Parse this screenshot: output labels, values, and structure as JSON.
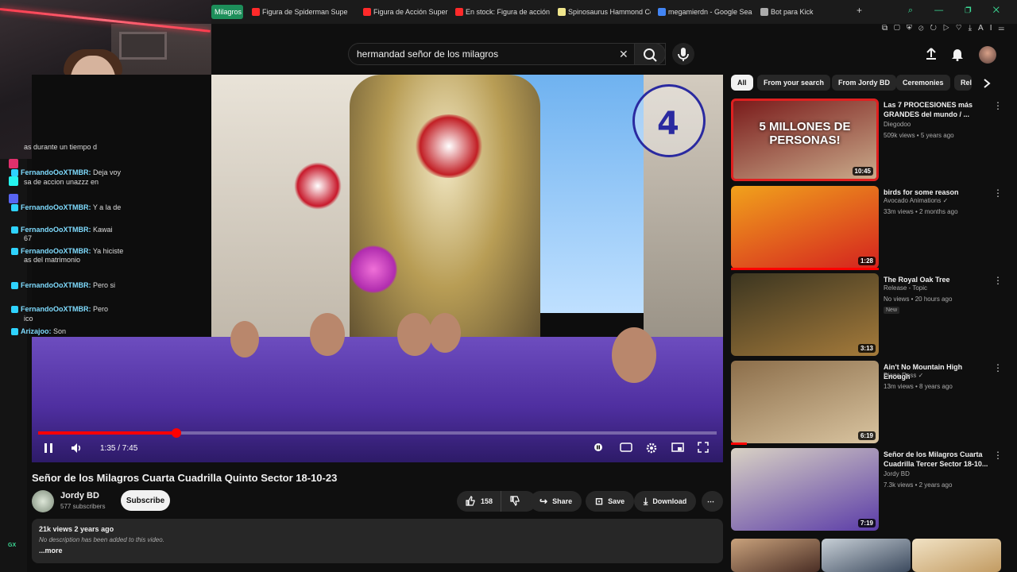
{
  "browser": {
    "tabs": [
      {
        "label": "Milagros C",
        "active": true,
        "fav": "#1d8f5a"
      },
      {
        "label": "Figura de Spiderman Supe",
        "fav": "#ff2a2a"
      },
      {
        "label": "Figura de Acción Superior",
        "fav": "#ff2a2a"
      },
      {
        "label": "En stock: Figura de acción",
        "fav": "#ff2a2a"
      },
      {
        "label": "Spinosaurus Hammond Co",
        "fav": "#f0e68c"
      },
      {
        "label": "megamierdn - Google Sea",
        "fav": "#4285f4"
      },
      {
        "label": "Bot para Kick",
        "fav": "#aaaaaa"
      }
    ],
    "new_tab": "+",
    "ext_ai": "AI"
  },
  "search": {
    "query": "hermandad señor de los milagros",
    "clear_icon": "✕",
    "search_icon": "🔍",
    "mic_icon": "🎙"
  },
  "header_icons": {
    "upload": "⤒",
    "bell": "🔔"
  },
  "chat": [
    {
      "user": "",
      "msg": "as durante un tiempo d"
    },
    {
      "user": "FernandoOoXTMBR:",
      "msg": "Deja voy"
    },
    {
      "user": "",
      "msg": "sa de accion unazzz en"
    },
    {
      "user": "FernandoOoXTMBR:",
      "msg": "Y a la de"
    },
    {
      "user": "FernandoOoXTMBR:",
      "msg": "Kawai"
    },
    {
      "user": "",
      "msg": "67"
    },
    {
      "user": "FernandoOoXTMBR:",
      "msg": "Ya hiciste"
    },
    {
      "user": "",
      "msg": "as del matrimonio"
    },
    {
      "user": "FernandoOoXTMBR:",
      "msg": "Pero si"
    },
    {
      "user": "FernandoOoXTMBR:",
      "msg": "Pero"
    },
    {
      "user": "",
      "msg": "ico"
    },
    {
      "user": "Arizajoo:",
      "msg": "Son"
    }
  ],
  "strip_label": "GX",
  "player": {
    "time": "1:35 / 7:45",
    "progress": 0.204,
    "watermark_number": "4"
  },
  "video": {
    "title": "Señor de los Milagros Cuarta Cuadrilla Quinto Sector 18-10-23",
    "channel": "Jordy BD",
    "subscribers": "577 subscribers",
    "subscribe_label": "Subscribe",
    "likes": "158",
    "share_label": "Share",
    "save_label": "Save",
    "download_label": "Download",
    "more_actions": "⋯",
    "views_date": "21k views  2 years ago",
    "description": "No description has been added to this video.",
    "more_label": "...more"
  },
  "chips": [
    "All",
    "From your search",
    "From Jordy BD",
    "Ceremonies",
    "Rel"
  ],
  "recommendations": [
    {
      "title": "Las 7 PROCESIONES más GRANDES del mundo / ...",
      "channel": "Diegodoo",
      "stats": "509k views • 5 years ago",
      "duration": "10:45",
      "thumb_text": "5 MILLONES DE PERSONAS!",
      "colors": [
        "#7a1b1b",
        "#c9aa8a"
      ]
    },
    {
      "title": "birds for some reason",
      "channel": "Avocado Animations ✓",
      "stats": "33m views • 2 months ago",
      "duration": "1:28",
      "colors": [
        "#f1a21c",
        "#d4231f"
      ]
    },
    {
      "title": "The Royal Oak Tree",
      "channel": "Release - Topic",
      "stats": "No views • 20 hours ago",
      "badge": "New",
      "duration": "3:13",
      "colors": [
        "#3b3520",
        "#a57b3b"
      ]
    },
    {
      "title": "Ain't No Mountain High Enough",
      "channel": "Diana Ross ✓",
      "stats": "13m views • 8 years ago",
      "duration": "6:19",
      "colors": [
        "#8c6e4a",
        "#d9c4a0"
      ]
    },
    {
      "title": "Señor de los Milagros Cuarta Cuadrilla Tercer Sector 18-10...",
      "channel": "Jordy BD",
      "stats": "7.3k views • 2 years ago",
      "duration": "7:19",
      "colors": [
        "#d9d2c4",
        "#5b3ca8"
      ]
    }
  ]
}
